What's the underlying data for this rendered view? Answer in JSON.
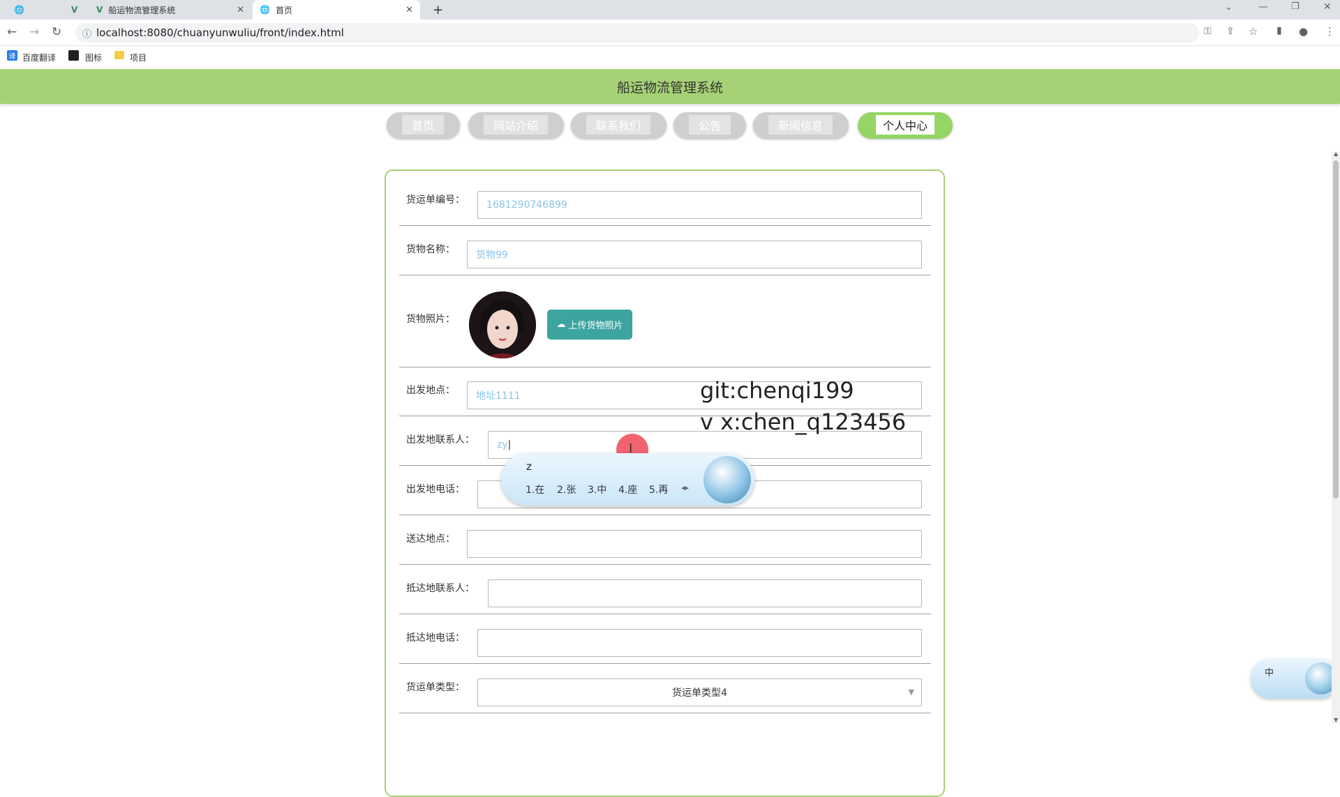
{
  "browser": {
    "tabs": [
      {
        "label": ""
      },
      {
        "label": ""
      },
      {
        "label": "船运物流管理系统"
      },
      {
        "label": "首页"
      }
    ],
    "url": "localhost:8080/chuanyunwuliu/front/index.html",
    "bookmarks": [
      "百度翻译",
      "图标",
      "项目"
    ]
  },
  "header": {
    "title": "船运物流管理系统"
  },
  "nav": [
    "首页",
    "网站介绍",
    "联系我们",
    "公告",
    "新闻信息",
    "个人中心"
  ],
  "form": {
    "order_no_label": "货运单编号：",
    "order_no_value": "1681290746899",
    "goods_name_label": "货物名称：",
    "goods_name_value": "货物99",
    "goods_photo_label": "货物照片：",
    "upload_label": "上传货物照片",
    "origin_label": "出发地点：",
    "origin_value": "地址1111",
    "origin_contact_label": "出发地联系人：",
    "origin_contact_value": "zy",
    "origin_phone_label": "出发地电话：",
    "dest_label": "送达地点：",
    "dest_contact_label": "抵达地联系人：",
    "dest_phone_label": "抵达地电话：",
    "type_label": "货运单类型：",
    "type_value": "货运单类型4"
  },
  "watermark": {
    "line1": "git:chenqi199",
    "line2": "v x:chen_q123456"
  },
  "ime": {
    "input": "z",
    "candidates": [
      "1.在",
      "2.张",
      "3.中",
      "4.座",
      "5.再"
    ],
    "mode": "中"
  }
}
